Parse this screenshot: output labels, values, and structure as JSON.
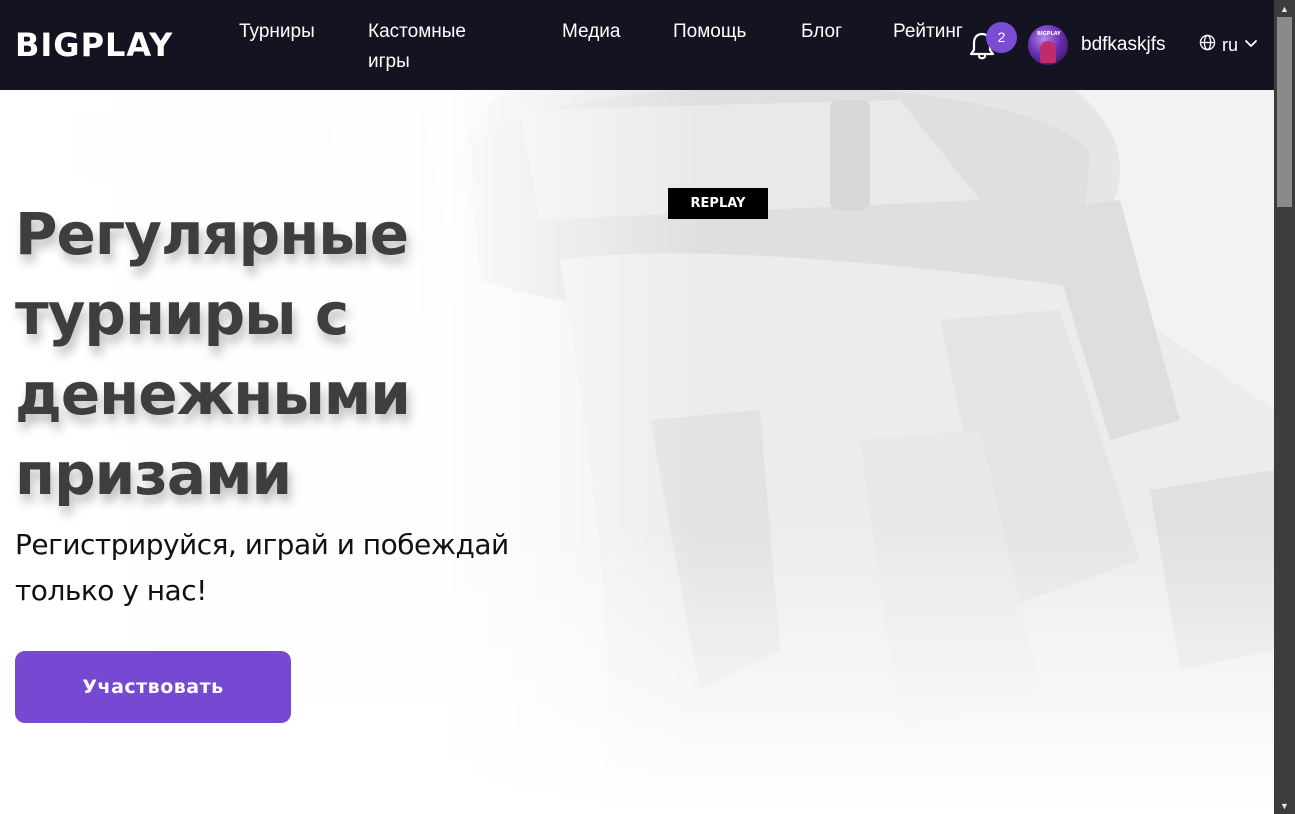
{
  "header": {
    "logo": "BIGPLAY",
    "nav": [
      {
        "label": "Турниры"
      },
      {
        "label": "Кастомные игры"
      },
      {
        "label": "Медиа"
      },
      {
        "label": "Помощь"
      },
      {
        "label": "Блог"
      },
      {
        "label": "Рейтинг"
      }
    ],
    "notifications": {
      "count": "2",
      "icon": "bell-icon"
    },
    "user": {
      "avatar_text": "BIGPLAY",
      "name": "bdfkaskjfs"
    },
    "language": {
      "code": "ru",
      "icon": "globe-icon",
      "chevron": "chevron-down-icon"
    }
  },
  "hero": {
    "replay_tag": "REPLAY",
    "title": "Регулярные турниры с денежными призами",
    "subtitle": "Регистрируйся, играй и побеждай только у нас!",
    "cta_label": "Участвовать"
  },
  "colors": {
    "header_bg": "#141321",
    "accent": "#7748d2",
    "badge": "#7a4cd6",
    "title_text": "#3e3e3e"
  }
}
